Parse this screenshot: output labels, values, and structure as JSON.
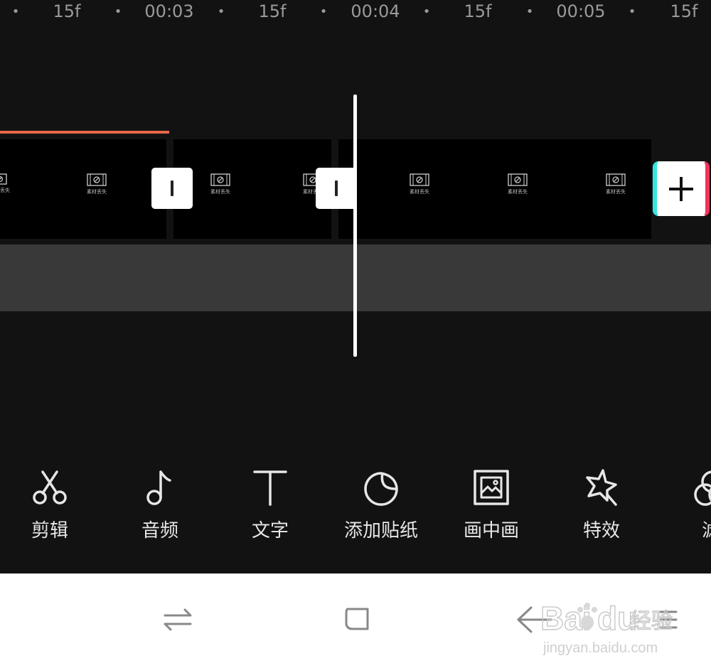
{
  "ruler": {
    "labels": [
      "15f",
      "00:03",
      "15f",
      "00:04",
      "15f",
      "00:05",
      "15f"
    ],
    "dot": "•"
  },
  "timeline": {
    "frame_caption": "素材丢失"
  },
  "toolbar": {
    "items": [
      {
        "label": "剪辑",
        "icon": "scissors-icon"
      },
      {
        "label": "音频",
        "icon": "music-note-icon"
      },
      {
        "label": "文字",
        "icon": "text-icon"
      },
      {
        "label": "添加贴纸",
        "icon": "sticker-icon"
      },
      {
        "label": "画中画",
        "icon": "picture-in-picture-icon"
      },
      {
        "label": "特效",
        "icon": "star-effects-icon"
      },
      {
        "label": "滤",
        "icon": "filter-icon"
      }
    ]
  },
  "navbar": {
    "icons": [
      "recent-apps-icon",
      "home-icon",
      "back-icon",
      "menu-icon"
    ]
  },
  "watermark": {
    "brand": "Bai",
    "brand2": "du",
    "cn": "经验",
    "url": "jingyan.baidu.com"
  },
  "colors": {
    "background": "#121212",
    "clip": "#000000",
    "audio_accent": "#e8674a",
    "add_cyan": "#33e6df",
    "add_red": "#f0335a"
  }
}
